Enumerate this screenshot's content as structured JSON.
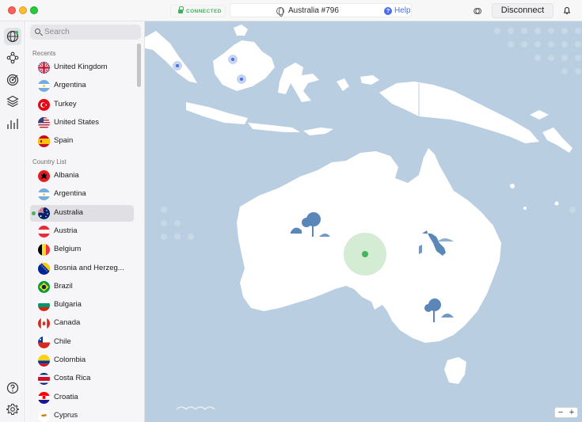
{
  "status": {
    "label": "CONNECTED",
    "color": "#3cb45a"
  },
  "server": {
    "name": "Australia #796"
  },
  "help": {
    "label": "Help"
  },
  "disconnect": {
    "label": "Disconnect"
  },
  "search": {
    "placeholder": "Search"
  },
  "sections": {
    "recents": "Recents",
    "country_list": "Country List"
  },
  "recents": [
    {
      "name": "United Kingdom",
      "flag": "uk"
    },
    {
      "name": "Argentina",
      "flag": "ar"
    },
    {
      "name": "Turkey",
      "flag": "tr"
    },
    {
      "name": "United States",
      "flag": "us"
    },
    {
      "name": "Spain",
      "flag": "es"
    }
  ],
  "countries": [
    {
      "name": "Albania",
      "flag": "al"
    },
    {
      "name": "Argentina",
      "flag": "ar"
    },
    {
      "name": "Australia",
      "flag": "au",
      "selected": true
    },
    {
      "name": "Austria",
      "flag": "at"
    },
    {
      "name": "Belgium",
      "flag": "be"
    },
    {
      "name": "Bosnia and Herzeg...",
      "flag": "ba"
    },
    {
      "name": "Brazil",
      "flag": "br"
    },
    {
      "name": "Bulgaria",
      "flag": "bg"
    },
    {
      "name": "Canada",
      "flag": "ca"
    },
    {
      "name": "Chile",
      "flag": "cl"
    },
    {
      "name": "Colombia",
      "flag": "co"
    },
    {
      "name": "Costa Rica",
      "flag": "cr"
    },
    {
      "name": "Croatia",
      "flag": "hr"
    },
    {
      "name": "Cyprus",
      "flag": "cy"
    }
  ],
  "zoom": {
    "minus": "−",
    "plus": "+"
  },
  "colors": {
    "ocean": "#b9cee0",
    "land": "#ffffff",
    "accent": "#4a6df0",
    "connected": "#44b45c"
  }
}
